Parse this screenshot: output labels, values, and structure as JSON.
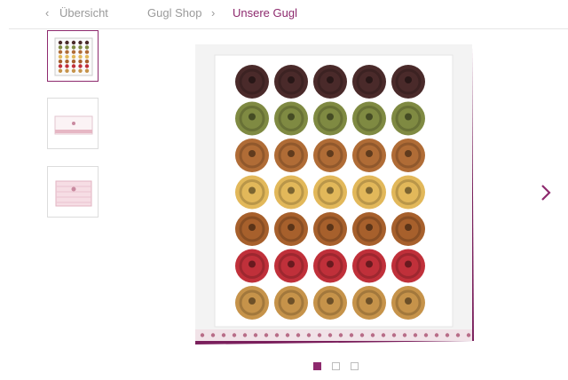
{
  "breadcrumb": {
    "back_label": "Übersicht",
    "shop_label": "Gugl Shop",
    "current_label": "Unsere Gugl"
  },
  "gallery": {
    "thumbnails": [
      "gugl-box-open",
      "gugl-box-closed-front",
      "gugl-box-closed-top"
    ],
    "selected_index": 0,
    "slide_count": 3,
    "active_slide": 1
  },
  "colors": {
    "accent": "#8e2a6e",
    "muted": "#9a9a9a",
    "rows": [
      "#4a2a2a",
      "#7f8a42",
      "#b06c36",
      "#e2b85a",
      "#a7602c",
      "#c0303a",
      "#c6934a"
    ]
  },
  "icons": {
    "back": "chevron-left-icon",
    "separator": "chevron-right-icon",
    "next": "chevron-right-icon"
  }
}
